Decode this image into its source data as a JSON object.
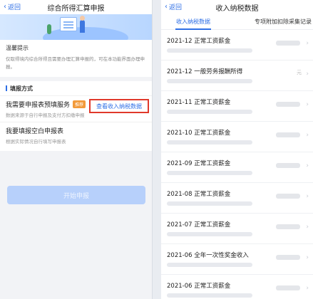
{
  "left": {
    "nav": {
      "back_label": "返回",
      "title": "综合所得汇算申报"
    },
    "tip": {
      "title": "温馨提示",
      "text": "仅取得境内综合所得且需要办理汇算申报的，可在本功能界面办理申报。"
    },
    "method": {
      "title": "填报方式",
      "query_link": "查看收入纳税数据",
      "options": [
        {
          "title": "我需要申报表预填服务",
          "badge": "推荐",
          "desc": "数据来源于自行申报及支付方扣缴申报"
        },
        {
          "title": "我要填报空白申报表",
          "desc": "根据实际情况自行填写申报表"
        }
      ]
    },
    "start_button": "开始申报"
  },
  "right": {
    "nav": {
      "back_label": "返回",
      "title": "收入纳税数据"
    },
    "tabs": [
      "收入纳税数据",
      "专项附加扣除采集记录"
    ],
    "records": [
      {
        "period": "2021-12",
        "type": "正常工资薪金"
      },
      {
        "period": "2021-12",
        "type": "一般劳务报酬所得",
        "trail": "元"
      },
      {
        "period": "2021-11",
        "type": "正常工资薪金"
      },
      {
        "period": "2021-10",
        "type": "正常工资薪金"
      },
      {
        "period": "2021-09",
        "type": "正常工资薪金"
      },
      {
        "period": "2021-08",
        "type": "正常工资薪金"
      },
      {
        "period": "2021-07",
        "type": "正常工资薪金"
      },
      {
        "period": "2021-06",
        "type": "全年一次性奖金收入"
      },
      {
        "period": "2021-06",
        "type": "正常工资薪金"
      }
    ]
  },
  "colors": {
    "accent": "#2e6fe6",
    "highlight": "#e0392b",
    "badge": "#f29a3a",
    "button_disabled": "#b7d0fb"
  },
  "icons": {
    "back": "chevron-left-icon",
    "row": "chevron-right-icon"
  }
}
